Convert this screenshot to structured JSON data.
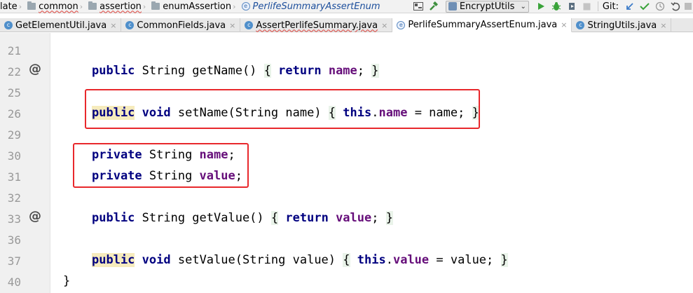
{
  "breadcrumbs": [
    "late",
    "common",
    "assertion",
    "enumAssertion",
    "PerlifeSummaryAssertEnum"
  ],
  "toolbar": {
    "config_name": "EncryptUtils",
    "git_label": "Git:"
  },
  "tabs": [
    {
      "label": "GetElementUtil.java",
      "close": "×",
      "active": false
    },
    {
      "label": "CommonFields.java",
      "close": "×",
      "active": false
    },
    {
      "label": "AssertPerlifeSummary.java",
      "close": "×",
      "active": false
    },
    {
      "label": "PerlifeSummaryAssertEnum.java",
      "close": "×",
      "active": true
    },
    {
      "label": "StringUtils.java",
      "close": "×",
      "active": false
    }
  ],
  "icons": {
    "class_glyph": "c",
    "enum_glyph": "e",
    "override_glyph": "@",
    "chevron": "⌄",
    "separator": "›"
  },
  "line_numbers": [
    "21",
    "22",
    "25",
    "26",
    "29",
    "30",
    "31",
    "32",
    "33",
    "36",
    "37",
    "40"
  ],
  "code": {
    "line22": {
      "kw1": "public",
      "t1": " String getName() ",
      "b1": "{",
      "sp1": " ",
      "kw2": "return",
      "sp2": " ",
      "f1": "name",
      "t2": "; ",
      "b2": "}"
    },
    "line26": {
      "kw1": "public",
      "sp0": " ",
      "kw2": "void",
      "t1": " setName(String name) ",
      "b1": "{",
      "sp1": " ",
      "kw3": "this",
      "t2": ".",
      "f1": "name",
      "t3": " = name; ",
      "b2": "}"
    },
    "line30": {
      "kw1": "private",
      "t1": " String ",
      "f1": "name",
      "t2": ";"
    },
    "line31": {
      "kw1": "private",
      "t1": " String ",
      "f1": "value",
      "t2": ";"
    },
    "line33": {
      "kw1": "public",
      "t1": " String getValue() ",
      "b1": "{",
      "sp1": " ",
      "kw2": "return",
      "sp2": " ",
      "f1": "value",
      "t2": "; ",
      "b2": "}"
    },
    "line37": {
      "kw1": "public",
      "sp0": " ",
      "kw2": "void",
      "t1": " setValue(String value) ",
      "b1": "{",
      "sp1": " ",
      "kw3": "this",
      "t2": ".",
      "f1": "value",
      "t3": " = value; ",
      "b2": "}"
    },
    "line40": "}"
  },
  "colors": {
    "keyword": "#000080",
    "field": "#660e7a",
    "annotation_box": "#e8282c"
  }
}
